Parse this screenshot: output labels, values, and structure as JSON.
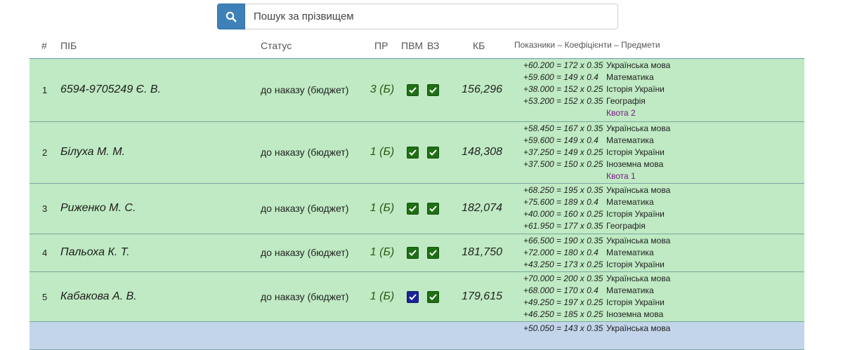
{
  "search": {
    "placeholder": "Пошук за прізвищем",
    "icon": "search-icon",
    "button_color": "#3e80b8"
  },
  "table": {
    "headers": {
      "num": "#",
      "name": "ПІБ",
      "status": "Статус",
      "pr": "ПР",
      "pvm": "ПВМ",
      "vz": "ВЗ",
      "kb": "КБ",
      "scores": "Показники – Коефіцієнти – Предмети"
    },
    "colors": {
      "row_green": "#bfeac3",
      "row_blue": "#c3d5ea",
      "check_green": "#1f6f14",
      "check_navy": "#1a2496",
      "quota": "#7a1a86"
    },
    "rows": [
      {
        "num": "1",
        "name": "6594-9705249 Є. В.",
        "status": "до наказу (бюджет)",
        "pr": "3 (Б)",
        "pvm_checked": true,
        "pvm_style": "green",
        "vz_checked": true,
        "kb": "156,296",
        "scores": [
          {
            "calc": "+60.200 = 172 x 0.35",
            "subject": "Українська мова"
          },
          {
            "calc": "+59.600 = 149 x 0.4",
            "subject": "Математика"
          },
          {
            "calc": "+38.000 = 152 x 0.25",
            "subject": "Історія України"
          },
          {
            "calc": "+53.200 = 152 x 0.35",
            "subject": "Географія"
          }
        ],
        "quota": "Квота 2"
      },
      {
        "num": "2",
        "name": "Білуха М. М.",
        "status": "до наказу (бюджет)",
        "pr": "1 (Б)",
        "pvm_checked": true,
        "pvm_style": "green",
        "vz_checked": true,
        "kb": "148,308",
        "scores": [
          {
            "calc": "+58.450 = 167 x 0.35",
            "subject": "Українська мова"
          },
          {
            "calc": "+59.600 = 149 x 0.4",
            "subject": "Математика"
          },
          {
            "calc": "+37.250 = 149 x 0.25",
            "subject": "Історія України"
          },
          {
            "calc": "+37.500 = 150 x 0.25",
            "subject": "Іноземна мова"
          }
        ],
        "quota": "Квота 1"
      },
      {
        "num": "3",
        "name": "Риженко М. С.",
        "status": "до наказу (бюджет)",
        "pr": "1 (Б)",
        "pvm_checked": true,
        "pvm_style": "green",
        "vz_checked": true,
        "kb": "182,074",
        "scores": [
          {
            "calc": "+68.250 = 195 x 0.35",
            "subject": "Українська мова"
          },
          {
            "calc": "+75.600 = 189 x 0.4",
            "subject": "Математика"
          },
          {
            "calc": "+40.000 = 160 x 0.25",
            "subject": "Історія України"
          },
          {
            "calc": "+61.950 = 177 x 0.35",
            "subject": "Географія"
          }
        ],
        "quota": ""
      },
      {
        "num": "4",
        "name": "Пальоха К. Т.",
        "status": "до наказу (бюджет)",
        "pr": "1 (Б)",
        "pvm_checked": true,
        "pvm_style": "green",
        "vz_checked": true,
        "kb": "181,750",
        "scores": [
          {
            "calc": "+66.500 = 190 x 0.35",
            "subject": "Українська мова"
          },
          {
            "calc": "+72.000 = 180 x 0.4",
            "subject": "Математика"
          },
          {
            "calc": "+43.250 = 173 x 0.25",
            "subject": "Історія України"
          }
        ],
        "quota": ""
      },
      {
        "num": "5",
        "name": "Кабакова А. В.",
        "status": "до наказу (бюджет)",
        "pr": "1 (Б)",
        "pvm_checked": true,
        "pvm_style": "navy",
        "vz_checked": true,
        "kb": "179,615",
        "scores": [
          {
            "calc": "+70.000 = 200 x 0.35",
            "subject": "Українська мова"
          },
          {
            "calc": "+68.000 = 170 x 0.4",
            "subject": "Математика"
          },
          {
            "calc": "+49.250 = 197 x 0.25",
            "subject": "Історія України"
          },
          {
            "calc": "+46.250 = 185 x 0.25",
            "subject": "Іноземна мова"
          }
        ],
        "quota": ""
      },
      {
        "num": "",
        "name": "",
        "status": "",
        "pr": "",
        "pvm_checked": false,
        "pvm_style": "",
        "vz_checked": false,
        "kb": "",
        "scores": [
          {
            "calc": "+50.050 = 143 x 0.35",
            "subject": "Українська мова"
          }
        ],
        "quota": ""
      }
    ]
  }
}
